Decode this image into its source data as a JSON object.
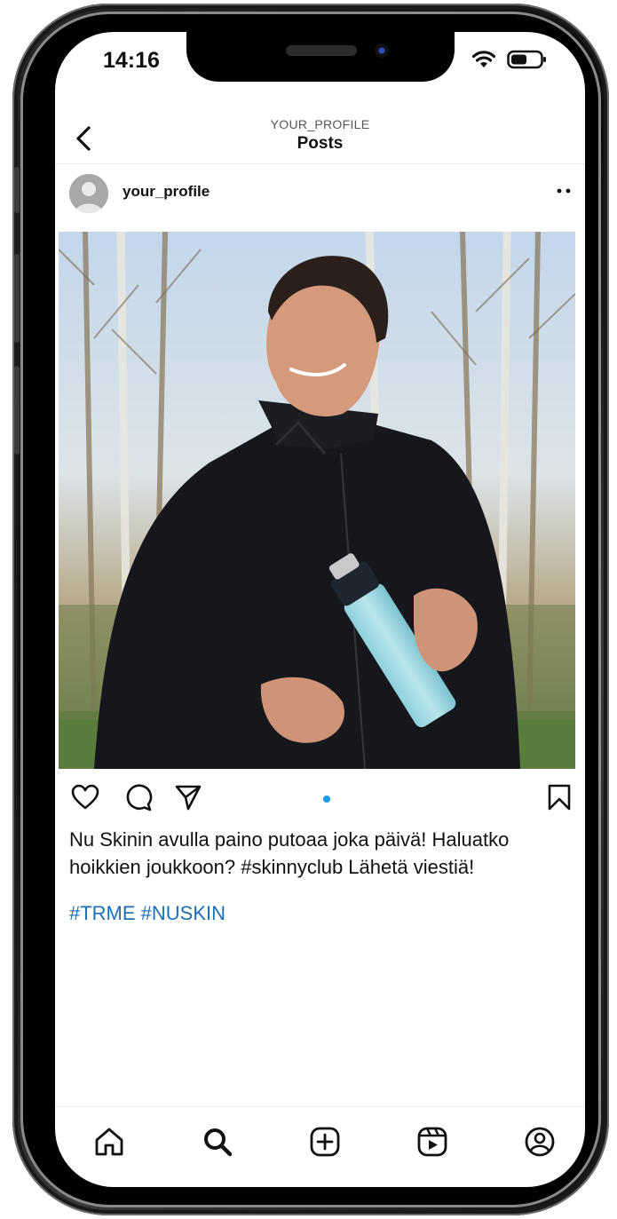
{
  "status_bar": {
    "time": "14:16"
  },
  "header": {
    "subtitle": "YOUR_PROFILE",
    "title": "Posts"
  },
  "post": {
    "username": "your_profile",
    "caption": "Nu Skinin avulla paino putoaa joka päivä! Haluatko hoikkien joukkoon? #skinnyclub Lähetä viestiä!",
    "hashtags": "#TRME #NUSKIN"
  },
  "colors": {
    "accent": "#1a9cf0",
    "hashtag": "#1d6fb5",
    "text": "#111111"
  },
  "icons": {
    "header": [
      "back-icon"
    ],
    "post_actions": [
      "heart-icon",
      "comment-icon",
      "share-icon",
      "bookmark-icon"
    ],
    "tabbar": [
      "home-icon",
      "search-icon",
      "add-icon",
      "reels-icon",
      "profile-icon"
    ]
  }
}
